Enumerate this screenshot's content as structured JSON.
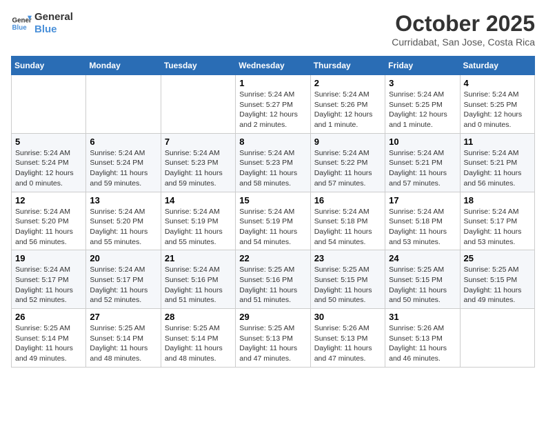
{
  "logo": {
    "line1": "General",
    "line2": "Blue"
  },
  "title": "October 2025",
  "subtitle": "Curridabat, San Jose, Costa Rica",
  "weekdays": [
    "Sunday",
    "Monday",
    "Tuesday",
    "Wednesday",
    "Thursday",
    "Friday",
    "Saturday"
  ],
  "weeks": [
    [
      {
        "day": "",
        "info": ""
      },
      {
        "day": "",
        "info": ""
      },
      {
        "day": "",
        "info": ""
      },
      {
        "day": "1",
        "info": "Sunrise: 5:24 AM\nSunset: 5:27 PM\nDaylight: 12 hours\nand 2 minutes."
      },
      {
        "day": "2",
        "info": "Sunrise: 5:24 AM\nSunset: 5:26 PM\nDaylight: 12 hours\nand 1 minute."
      },
      {
        "day": "3",
        "info": "Sunrise: 5:24 AM\nSunset: 5:25 PM\nDaylight: 12 hours\nand 1 minute."
      },
      {
        "day": "4",
        "info": "Sunrise: 5:24 AM\nSunset: 5:25 PM\nDaylight: 12 hours\nand 0 minutes."
      }
    ],
    [
      {
        "day": "5",
        "info": "Sunrise: 5:24 AM\nSunset: 5:24 PM\nDaylight: 12 hours\nand 0 minutes."
      },
      {
        "day": "6",
        "info": "Sunrise: 5:24 AM\nSunset: 5:24 PM\nDaylight: 11 hours\nand 59 minutes."
      },
      {
        "day": "7",
        "info": "Sunrise: 5:24 AM\nSunset: 5:23 PM\nDaylight: 11 hours\nand 59 minutes."
      },
      {
        "day": "8",
        "info": "Sunrise: 5:24 AM\nSunset: 5:23 PM\nDaylight: 11 hours\nand 58 minutes."
      },
      {
        "day": "9",
        "info": "Sunrise: 5:24 AM\nSunset: 5:22 PM\nDaylight: 11 hours\nand 57 minutes."
      },
      {
        "day": "10",
        "info": "Sunrise: 5:24 AM\nSunset: 5:21 PM\nDaylight: 11 hours\nand 57 minutes."
      },
      {
        "day": "11",
        "info": "Sunrise: 5:24 AM\nSunset: 5:21 PM\nDaylight: 11 hours\nand 56 minutes."
      }
    ],
    [
      {
        "day": "12",
        "info": "Sunrise: 5:24 AM\nSunset: 5:20 PM\nDaylight: 11 hours\nand 56 minutes."
      },
      {
        "day": "13",
        "info": "Sunrise: 5:24 AM\nSunset: 5:20 PM\nDaylight: 11 hours\nand 55 minutes."
      },
      {
        "day": "14",
        "info": "Sunrise: 5:24 AM\nSunset: 5:19 PM\nDaylight: 11 hours\nand 55 minutes."
      },
      {
        "day": "15",
        "info": "Sunrise: 5:24 AM\nSunset: 5:19 PM\nDaylight: 11 hours\nand 54 minutes."
      },
      {
        "day": "16",
        "info": "Sunrise: 5:24 AM\nSunset: 5:18 PM\nDaylight: 11 hours\nand 54 minutes."
      },
      {
        "day": "17",
        "info": "Sunrise: 5:24 AM\nSunset: 5:18 PM\nDaylight: 11 hours\nand 53 minutes."
      },
      {
        "day": "18",
        "info": "Sunrise: 5:24 AM\nSunset: 5:17 PM\nDaylight: 11 hours\nand 53 minutes."
      }
    ],
    [
      {
        "day": "19",
        "info": "Sunrise: 5:24 AM\nSunset: 5:17 PM\nDaylight: 11 hours\nand 52 minutes."
      },
      {
        "day": "20",
        "info": "Sunrise: 5:24 AM\nSunset: 5:17 PM\nDaylight: 11 hours\nand 52 minutes."
      },
      {
        "day": "21",
        "info": "Sunrise: 5:24 AM\nSunset: 5:16 PM\nDaylight: 11 hours\nand 51 minutes."
      },
      {
        "day": "22",
        "info": "Sunrise: 5:25 AM\nSunset: 5:16 PM\nDaylight: 11 hours\nand 51 minutes."
      },
      {
        "day": "23",
        "info": "Sunrise: 5:25 AM\nSunset: 5:15 PM\nDaylight: 11 hours\nand 50 minutes."
      },
      {
        "day": "24",
        "info": "Sunrise: 5:25 AM\nSunset: 5:15 PM\nDaylight: 11 hours\nand 50 minutes."
      },
      {
        "day": "25",
        "info": "Sunrise: 5:25 AM\nSunset: 5:15 PM\nDaylight: 11 hours\nand 49 minutes."
      }
    ],
    [
      {
        "day": "26",
        "info": "Sunrise: 5:25 AM\nSunset: 5:14 PM\nDaylight: 11 hours\nand 49 minutes."
      },
      {
        "day": "27",
        "info": "Sunrise: 5:25 AM\nSunset: 5:14 PM\nDaylight: 11 hours\nand 48 minutes."
      },
      {
        "day": "28",
        "info": "Sunrise: 5:25 AM\nSunset: 5:14 PM\nDaylight: 11 hours\nand 48 minutes."
      },
      {
        "day": "29",
        "info": "Sunrise: 5:25 AM\nSunset: 5:13 PM\nDaylight: 11 hours\nand 47 minutes."
      },
      {
        "day": "30",
        "info": "Sunrise: 5:26 AM\nSunset: 5:13 PM\nDaylight: 11 hours\nand 47 minutes."
      },
      {
        "day": "31",
        "info": "Sunrise: 5:26 AM\nSunset: 5:13 PM\nDaylight: 11 hours\nand 46 minutes."
      },
      {
        "day": "",
        "info": ""
      }
    ]
  ]
}
